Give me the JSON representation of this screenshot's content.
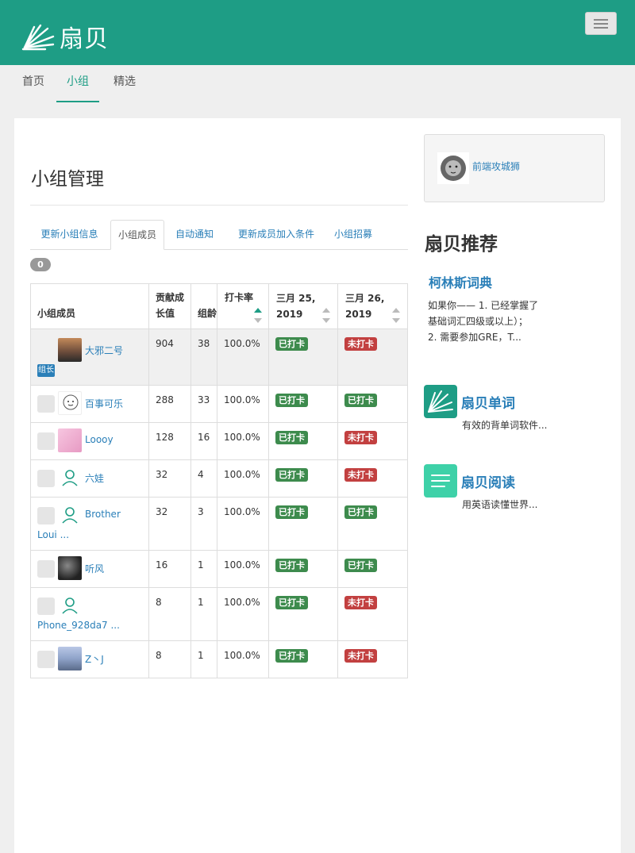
{
  "header": {
    "logo_text": "扇贝"
  },
  "subnav": {
    "items": [
      "首页",
      "小组",
      "精选"
    ],
    "active": "小组"
  },
  "page": {
    "title": "小组管理"
  },
  "tabs": [
    "更新小组信息",
    "小组成员",
    "自动通知",
    "更新成员加入条件",
    "小组招募"
  ],
  "active_tab": "小组成员",
  "member_count": "0",
  "table": {
    "headers": {
      "member": "小组成员",
      "contribution_line1": "贡献成",
      "contribution_line2": "长值",
      "days": "组龄",
      "rate": "打卡率",
      "day1_line1": "三月 25,",
      "day1_line2": "2019",
      "day2_line1": "三月 26,",
      "day2_line2": "2019"
    },
    "admin_tag": "组长",
    "rows": [
      {
        "name": "大邪二号",
        "contribution": "904",
        "days": "38",
        "rate": "100.0%",
        "day1": "已打卡",
        "day2": "未打卡"
      },
      {
        "name": "百事可乐",
        "contribution": "288",
        "days": "33",
        "rate": "100.0%",
        "day1": "已打卡",
        "day2": "已打卡"
      },
      {
        "name": "Loooy",
        "contribution": "128",
        "days": "16",
        "rate": "100.0%",
        "day1": "已打卡",
        "day2": "未打卡"
      },
      {
        "name": "六娃",
        "contribution": "32",
        "days": "4",
        "rate": "100.0%",
        "day1": "已打卡",
        "day2": "未打卡"
      },
      {
        "name": "Brother",
        "name_line2": "Loui ...",
        "contribution": "32",
        "days": "3",
        "rate": "100.0%",
        "day1": "已打卡",
        "day2": "已打卡"
      },
      {
        "name": "听风",
        "contribution": "16",
        "days": "1",
        "rate": "100.0%",
        "day1": "已打卡",
        "day2": "已打卡"
      },
      {
        "name": "Phone_928da7 ...",
        "contribution": "8",
        "days": "1",
        "rate": "100.0%",
        "day1": "已打卡",
        "day2": "未打卡"
      },
      {
        "name": "Z丶J",
        "contribution": "8",
        "days": "1",
        "rate": "100.0%",
        "day1": "已打卡",
        "day2": "未打卡"
      }
    ]
  },
  "sidebar": {
    "group_name": "前端攻城狮",
    "rec_title": "扇贝推荐",
    "rec1": {
      "title": "柯林斯词典",
      "desc": "如果你—— 1. 已经掌握了基础词汇四级或以上）； 2. 需要参加GRE，T..."
    },
    "app1": {
      "title": "扇贝单词",
      "desc": "有效的背单词软件..."
    },
    "app2": {
      "title": "扇贝阅读",
      "desc": "用英语读懂世界..."
    }
  },
  "colors": {
    "brand": "#1e9d85",
    "link": "#2a7fb8",
    "done": "#3d8b4d",
    "missed": "#c24040"
  }
}
